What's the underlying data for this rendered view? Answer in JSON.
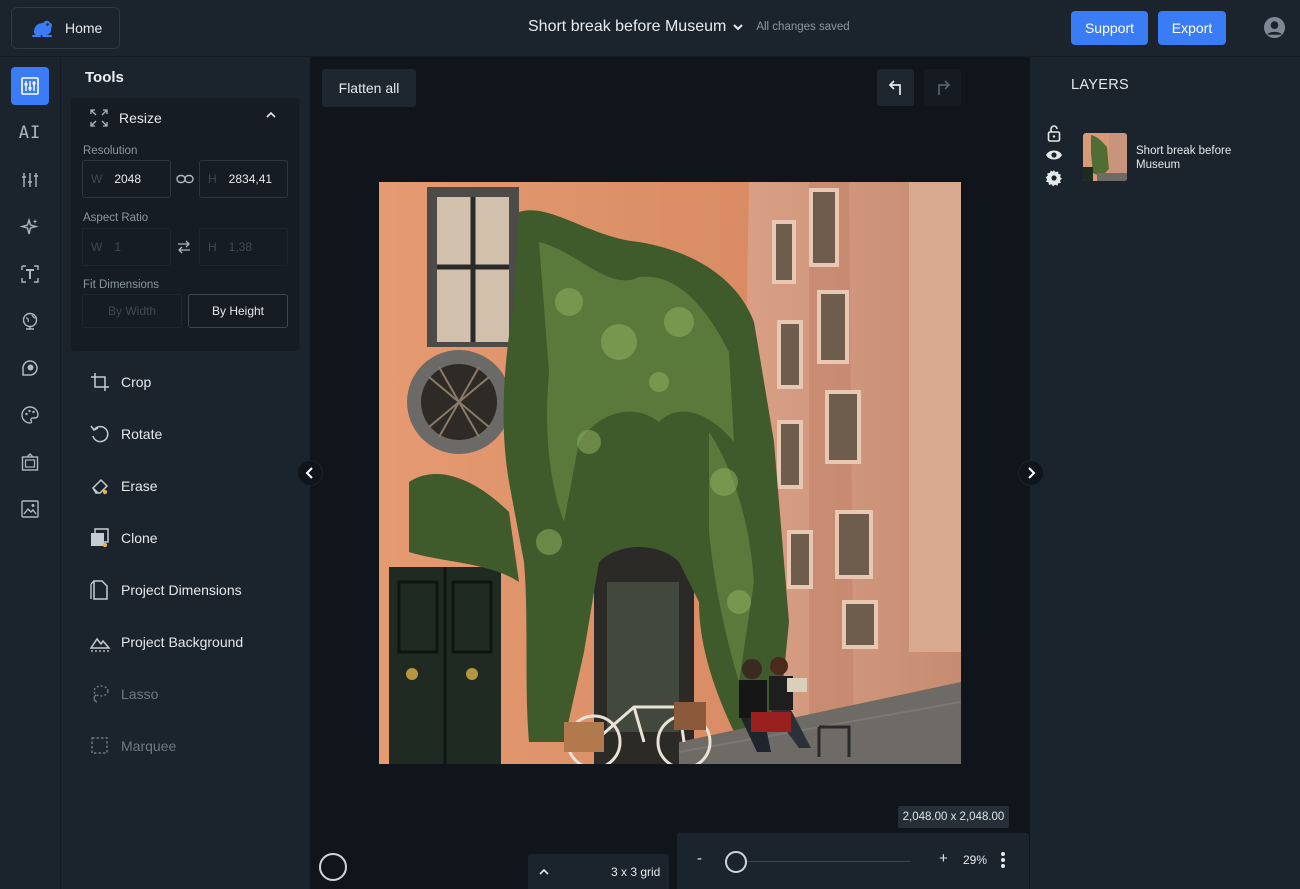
{
  "header": {
    "home_label": "Home",
    "title": "Short break before Museum",
    "saved_status": "All changes saved",
    "support_label": "Support",
    "export_label": "Export"
  },
  "rail": {
    "items": [
      {
        "icon": "adjust-tools-icon",
        "active": true
      },
      {
        "icon": "ai-text-icon",
        "label": "AI"
      },
      {
        "icon": "sliders-icon"
      },
      {
        "icon": "sparkle-icon"
      },
      {
        "icon": "text-box-icon"
      },
      {
        "icon": "globe-icon"
      },
      {
        "icon": "sticker-icon"
      },
      {
        "icon": "palette-icon"
      },
      {
        "icon": "frame-icon"
      },
      {
        "icon": "image-icon"
      }
    ]
  },
  "tools": {
    "title": "Tools",
    "resize": {
      "label": "Resize",
      "resolution_label": "Resolution",
      "width_prefix": "W",
      "width_value": "2048",
      "height_prefix": "H",
      "height_value": "2834,41",
      "aspect_label": "Aspect Ratio",
      "aspect_w_value": "1",
      "aspect_h_value": "1,38",
      "fit_label": "Fit Dimensions",
      "by_width": "By Width",
      "by_height": "By Height"
    },
    "items": [
      {
        "label": "Crop",
        "icon": "crop-icon",
        "enabled": true
      },
      {
        "label": "Rotate",
        "icon": "rotate-icon",
        "enabled": true
      },
      {
        "label": "Erase",
        "icon": "eraser-icon",
        "enabled": true
      },
      {
        "label": "Clone",
        "icon": "clone-icon",
        "enabled": true
      },
      {
        "label": "Project Dimensions",
        "icon": "page-dimensions-icon",
        "enabled": true
      },
      {
        "label": "Project Background",
        "icon": "mountain-background-icon",
        "enabled": true
      },
      {
        "label": "Lasso",
        "icon": "lasso-icon",
        "enabled": false
      },
      {
        "label": "Marquee",
        "icon": "marquee-icon",
        "enabled": false
      }
    ]
  },
  "canvas": {
    "flatten_label": "Flatten all",
    "dimensions": "2,048.00 x 2,048.00",
    "grid_label": "3 x 3 grid",
    "zoom_minus": "-",
    "zoom_plus": "+",
    "zoom_value": "29%",
    "zoom_level": 0.29
  },
  "layers": {
    "title": "LAYERS",
    "items": [
      {
        "name": "Short break before Museum",
        "locked": false,
        "visible": true
      }
    ]
  },
  "colors": {
    "accent": "#3a7cf6",
    "background": "#1b232c",
    "canvas": "#0f151b"
  }
}
